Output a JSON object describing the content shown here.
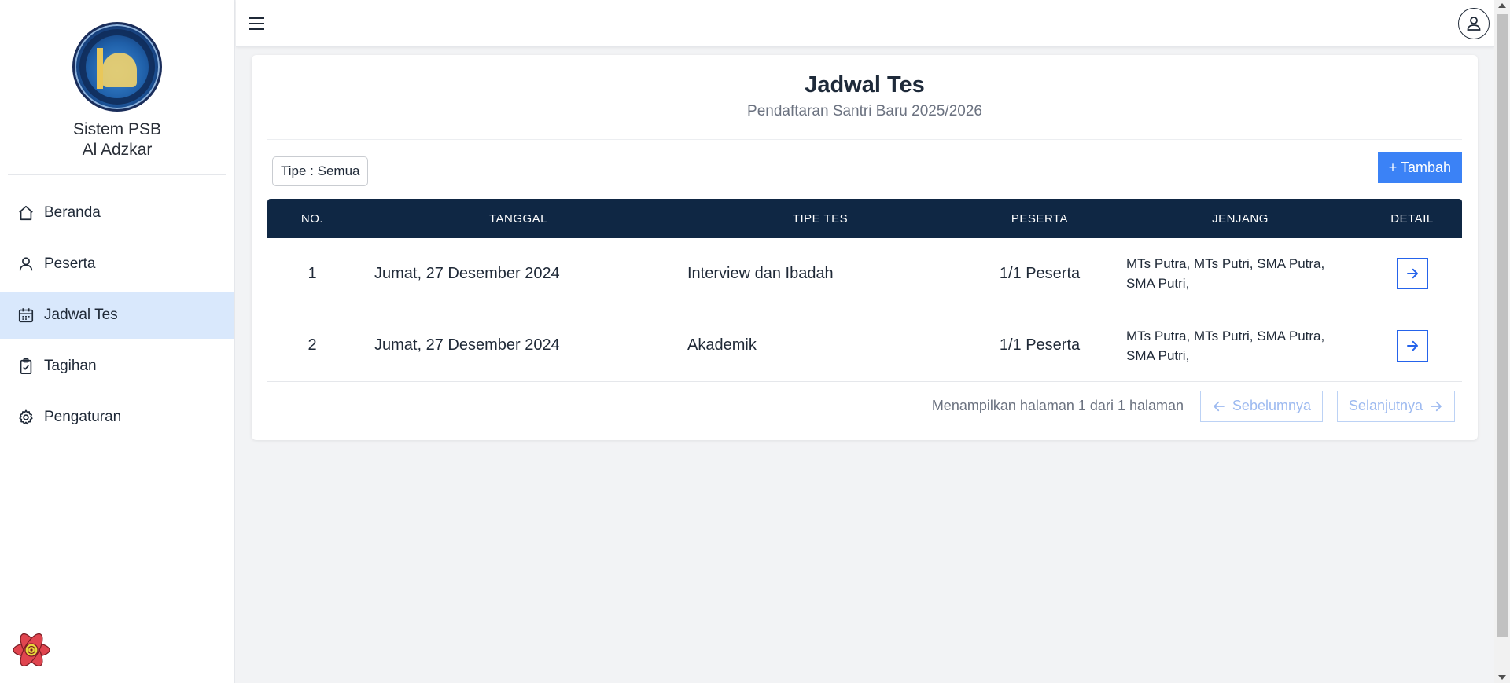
{
  "sidebar": {
    "brand_line1": "Sistem PSB",
    "brand_line2": "Al Adzkar",
    "items": [
      {
        "label": "Beranda",
        "icon": "home-icon"
      },
      {
        "label": "Peserta",
        "icon": "user-icon"
      },
      {
        "label": "Jadwal Tes",
        "icon": "calendar-icon",
        "active": true
      },
      {
        "label": "Tagihan",
        "icon": "clipboard-check-icon"
      },
      {
        "label": "Pengaturan",
        "icon": "gear-icon"
      }
    ]
  },
  "page": {
    "title": "Jadwal Tes",
    "subtitle": "Pendaftaran Santri Baru 2025/2026",
    "filter_label": "Tipe : Semua",
    "add_label": "+ Tambah"
  },
  "table": {
    "headers": [
      "NO.",
      "TANGGAL",
      "TIPE TES",
      "PESERTA",
      "JENJANG",
      "DETAIL"
    ],
    "rows": [
      {
        "no": "1",
        "tanggal": "Jumat, 27 Desember 2024",
        "tipe": "Interview dan Ibadah",
        "peserta": "1/1 Peserta",
        "jenjang": "MTs Putra, MTs Putri, SMA Putra, SMA Putri,"
      },
      {
        "no": "2",
        "tanggal": "Jumat, 27 Desember 2024",
        "tipe": "Akademik",
        "peserta": "1/1 Peserta",
        "jenjang": "MTs Putra, MTs Putri, SMA Putra, SMA Putri,"
      }
    ]
  },
  "pagination": {
    "info": "Menampilkan halaman 1 dari 1 halaman",
    "prev_label": "Sebelumnya",
    "next_label": "Selanjutnya"
  },
  "colors": {
    "accent": "#3b82f6",
    "table_header": "#0f2744",
    "active_nav": "#d9e8fc"
  }
}
